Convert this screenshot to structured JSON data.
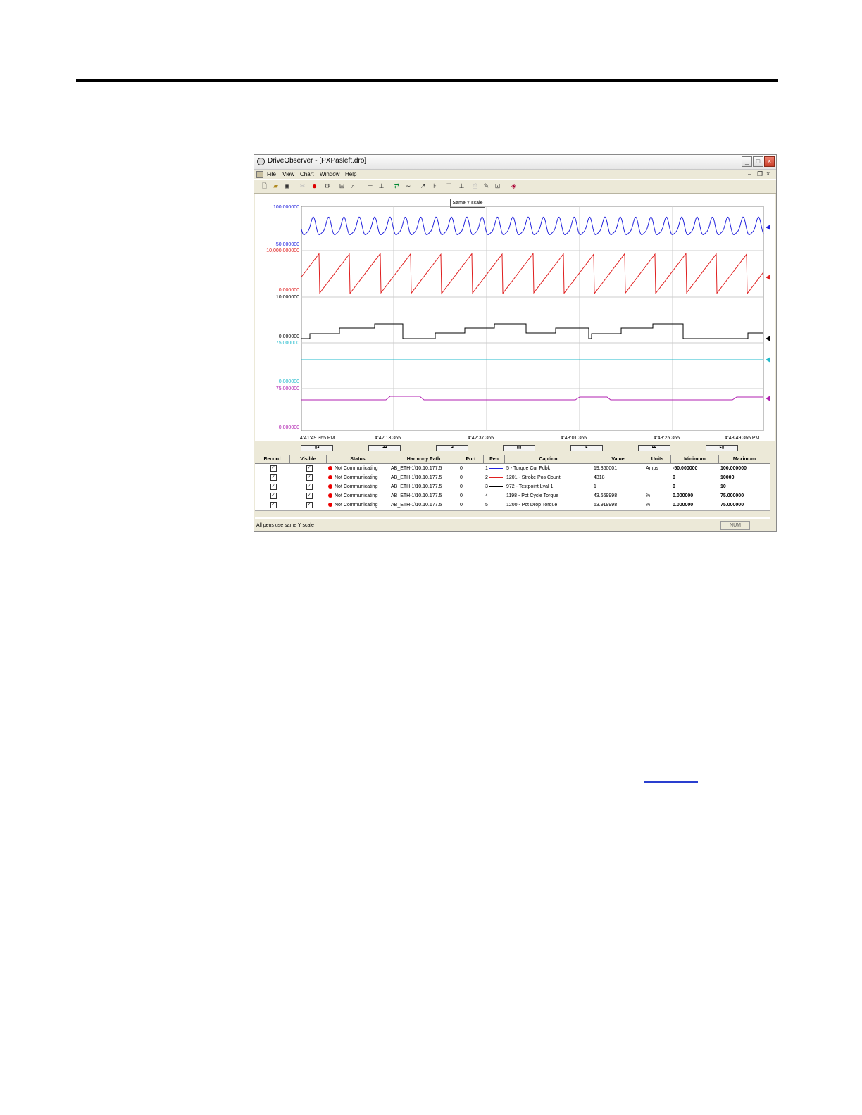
{
  "window": {
    "title": "DriveObserver - [PXPasleft.dro]",
    "menu": [
      "File",
      "View",
      "Chart",
      "Window",
      "Help"
    ]
  },
  "chart": {
    "scale_button": "Same Y scale",
    "pens": [
      {
        "max_label": "100.000000",
        "min_label": "-50.000000",
        "color": "#2222dd"
      },
      {
        "max_label": "10,000.000000",
        "min_label": "0.000000",
        "color": "#e02020"
      },
      {
        "max_label": "10.000000",
        "min_label": "0.000000",
        "color": "#000000"
      },
      {
        "max_label": "75.000000",
        "min_label": "0.000000",
        "color": "#22bbcc"
      },
      {
        "max_label": "75.000000",
        "min_label": "0.000000",
        "color": "#b020b0"
      }
    ],
    "time_labels": [
      "4:41:49.365 PM",
      "4:42:13.365",
      "4:42:37.365",
      "4:43:01.365",
      "4:43:25.365",
      "4:43:49.365 PM"
    ],
    "nav_buttons": [
      "first-icon",
      "rewind-icon",
      "back-icon",
      "pause-icon",
      "play-icon",
      "fast-forward-icon",
      "last-icon"
    ]
  },
  "grid": {
    "headers": [
      "Record",
      "Visible",
      "Status",
      "Harmony Path",
      "Port",
      "Pen",
      "Caption",
      "Value",
      "Units",
      "Minimum",
      "Maximum"
    ],
    "rows": [
      {
        "status": "Not Communicating",
        "path": "AB_ETH-1\\10.10.177.5",
        "port": "0",
        "pen": "1",
        "caption": "5 - Torque Cur Fdbk",
        "value": "19.360001",
        "units": "Amps",
        "min": "-50.000000",
        "max": "100.000000"
      },
      {
        "status": "Not Communicating",
        "path": "AB_ETH-1\\10.10.177.5",
        "port": "0",
        "pen": "2",
        "caption": "1201 - Stroke Pos Count",
        "value": "4318",
        "units": "",
        "min": "0",
        "max": "10000"
      },
      {
        "status": "Not Communicating",
        "path": "AB_ETH-1\\10.10.177.5",
        "port": "0",
        "pen": "3",
        "caption": "972 - Testpoint Lval 1",
        "value": "1",
        "units": "",
        "min": "0",
        "max": "10"
      },
      {
        "status": "Not Communicating",
        "path": "AB_ETH-1\\10.10.177.5",
        "port": "0",
        "pen": "4",
        "caption": "1198 - Pct Cycle Torque",
        "value": "43.669998",
        "units": "%",
        "min": "0.000000",
        "max": "75.000000"
      },
      {
        "status": "Not Communicating",
        "path": "AB_ETH-1\\10.10.177.5",
        "port": "0",
        "pen": "5",
        "caption": "1200 - Pct Drop Torque",
        "value": "53.919998",
        "units": "%",
        "min": "0.000000",
        "max": "75.000000"
      }
    ]
  },
  "statusbar": {
    "text": "All pens use same Y scale",
    "num": "NUM"
  }
}
